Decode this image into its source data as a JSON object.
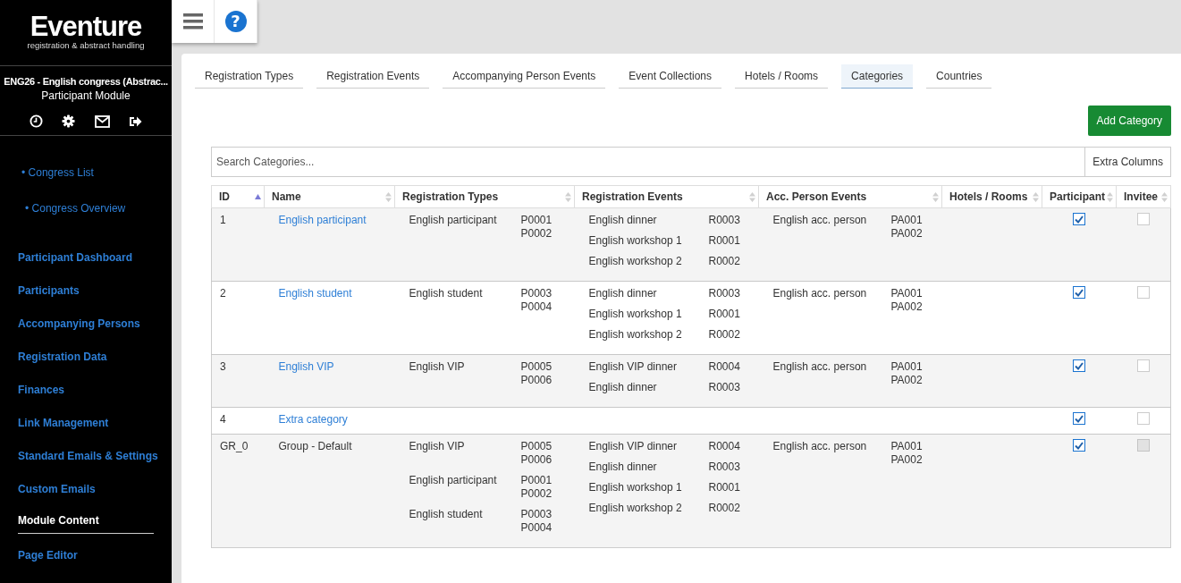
{
  "logo": {
    "name": "Eventure",
    "tagline": "registration & abstract handling"
  },
  "congress": {
    "title": "ENG26 - English congress (Abstrac...",
    "module": "Participant Module"
  },
  "help_button": {
    "label": "?"
  },
  "sidebar": {
    "congress_links": [
      {
        "label": "• Congress List"
      },
      {
        "label": "• Congress Overview"
      }
    ],
    "items": [
      {
        "label": "Participant Dashboard",
        "selected": false
      },
      {
        "label": "Participants",
        "selected": false
      },
      {
        "label": "Accompanying Persons",
        "selected": false
      },
      {
        "label": "Registration Data",
        "selected": false
      },
      {
        "label": "Finances",
        "selected": false
      },
      {
        "label": "Link Management",
        "selected": false
      },
      {
        "label": "Standard Emails & Settings",
        "selected": false
      },
      {
        "label": "Custom Emails",
        "selected": false
      },
      {
        "label": "Module Content",
        "selected": true
      },
      {
        "label": "Page Editor",
        "selected": false
      }
    ]
  },
  "tabs": [
    {
      "label": "Registration Types",
      "selected": false
    },
    {
      "label": "Registration Events",
      "selected": false
    },
    {
      "label": "Accompanying Person Events",
      "selected": false
    },
    {
      "label": "Event Collections",
      "selected": false
    },
    {
      "label": "Hotels / Rooms",
      "selected": false
    },
    {
      "label": "Categories",
      "selected": true
    },
    {
      "label": "Countries",
      "selected": false
    }
  ],
  "add_button": "Add Category",
  "search": {
    "placeholder": "Search Categories...",
    "extra_button": "Extra Columns"
  },
  "table": {
    "columns": [
      {
        "label": "ID",
        "sorted": true
      },
      {
        "label": "Name",
        "sorted": false
      },
      {
        "label": "Registration Types",
        "sorted": false
      },
      {
        "label": "Registration Events",
        "sorted": false
      },
      {
        "label": "Acc. Person Events",
        "sorted": false
      },
      {
        "label": "Hotels / Rooms",
        "sorted": false
      },
      {
        "label": "Participant",
        "sorted": false
      },
      {
        "label": "Invitee",
        "sorted": false
      }
    ],
    "rows": [
      {
        "id": "1",
        "name": "English participant",
        "linked": true,
        "registration_types": [
          {
            "name": "English participant",
            "codes": [
              "P0001",
              "P0002"
            ]
          }
        ],
        "registration_events": [
          {
            "name": "English dinner",
            "code": "R0003"
          },
          {
            "name": "English workshop 1",
            "code": "R0001"
          },
          {
            "name": "English workshop 2",
            "code": "R0002"
          }
        ],
        "acc_person_events": [
          {
            "name": "English acc. person",
            "codes": [
              "PA001",
              "PA002"
            ]
          }
        ],
        "participant": {
          "checked": true,
          "disabled": false
        },
        "invitee": {
          "checked": false,
          "disabled": false
        }
      },
      {
        "id": "2",
        "name": "English student",
        "linked": true,
        "registration_types": [
          {
            "name": "English student",
            "codes": [
              "P0003",
              "P0004"
            ]
          }
        ],
        "registration_events": [
          {
            "name": "English dinner",
            "code": "R0003"
          },
          {
            "name": "English workshop 1",
            "code": "R0001"
          },
          {
            "name": "English workshop 2",
            "code": "R0002"
          }
        ],
        "acc_person_events": [
          {
            "name": "English acc. person",
            "codes": [
              "PA001",
              "PA002"
            ]
          }
        ],
        "participant": {
          "checked": true,
          "disabled": false
        },
        "invitee": {
          "checked": false,
          "disabled": false
        }
      },
      {
        "id": "3",
        "name": "English VIP",
        "linked": true,
        "registration_types": [
          {
            "name": "English VIP",
            "codes": [
              "P0005",
              "P0006"
            ]
          }
        ],
        "registration_events": [
          {
            "name": "English VIP dinner",
            "code": "R0004"
          },
          {
            "name": "English dinner",
            "code": "R0003"
          }
        ],
        "acc_person_events": [
          {
            "name": "English acc. person",
            "codes": [
              "PA001",
              "PA002"
            ]
          }
        ],
        "participant": {
          "checked": true,
          "disabled": false
        },
        "invitee": {
          "checked": false,
          "disabled": false
        }
      },
      {
        "id": "4",
        "name": "Extra category",
        "linked": true,
        "registration_types": [],
        "registration_events": [],
        "acc_person_events": [],
        "participant": {
          "checked": true,
          "disabled": false
        },
        "invitee": {
          "checked": false,
          "disabled": false
        }
      },
      {
        "id": "GR_0",
        "name": "Group - Default",
        "linked": false,
        "registration_types": [
          {
            "name": "English VIP",
            "codes": [
              "P0005",
              "P0006"
            ]
          },
          {
            "name": "English participant",
            "codes": [
              "P0001",
              "P0002"
            ]
          },
          {
            "name": "English student",
            "codes": [
              "P0003",
              "P0004"
            ]
          }
        ],
        "registration_events": [
          {
            "name": "English VIP dinner",
            "code": "R0004"
          },
          {
            "name": "English dinner",
            "code": "R0003"
          },
          {
            "name": "English workshop 1",
            "code": "R0001"
          },
          {
            "name": "English workshop 2",
            "code": "R0002"
          }
        ],
        "acc_person_events": [
          {
            "name": "English acc. person",
            "codes": [
              "PA001",
              "PA002"
            ]
          }
        ],
        "participant": {
          "checked": true,
          "disabled": false
        },
        "invitee": {
          "checked": false,
          "disabled": true
        }
      }
    ]
  }
}
